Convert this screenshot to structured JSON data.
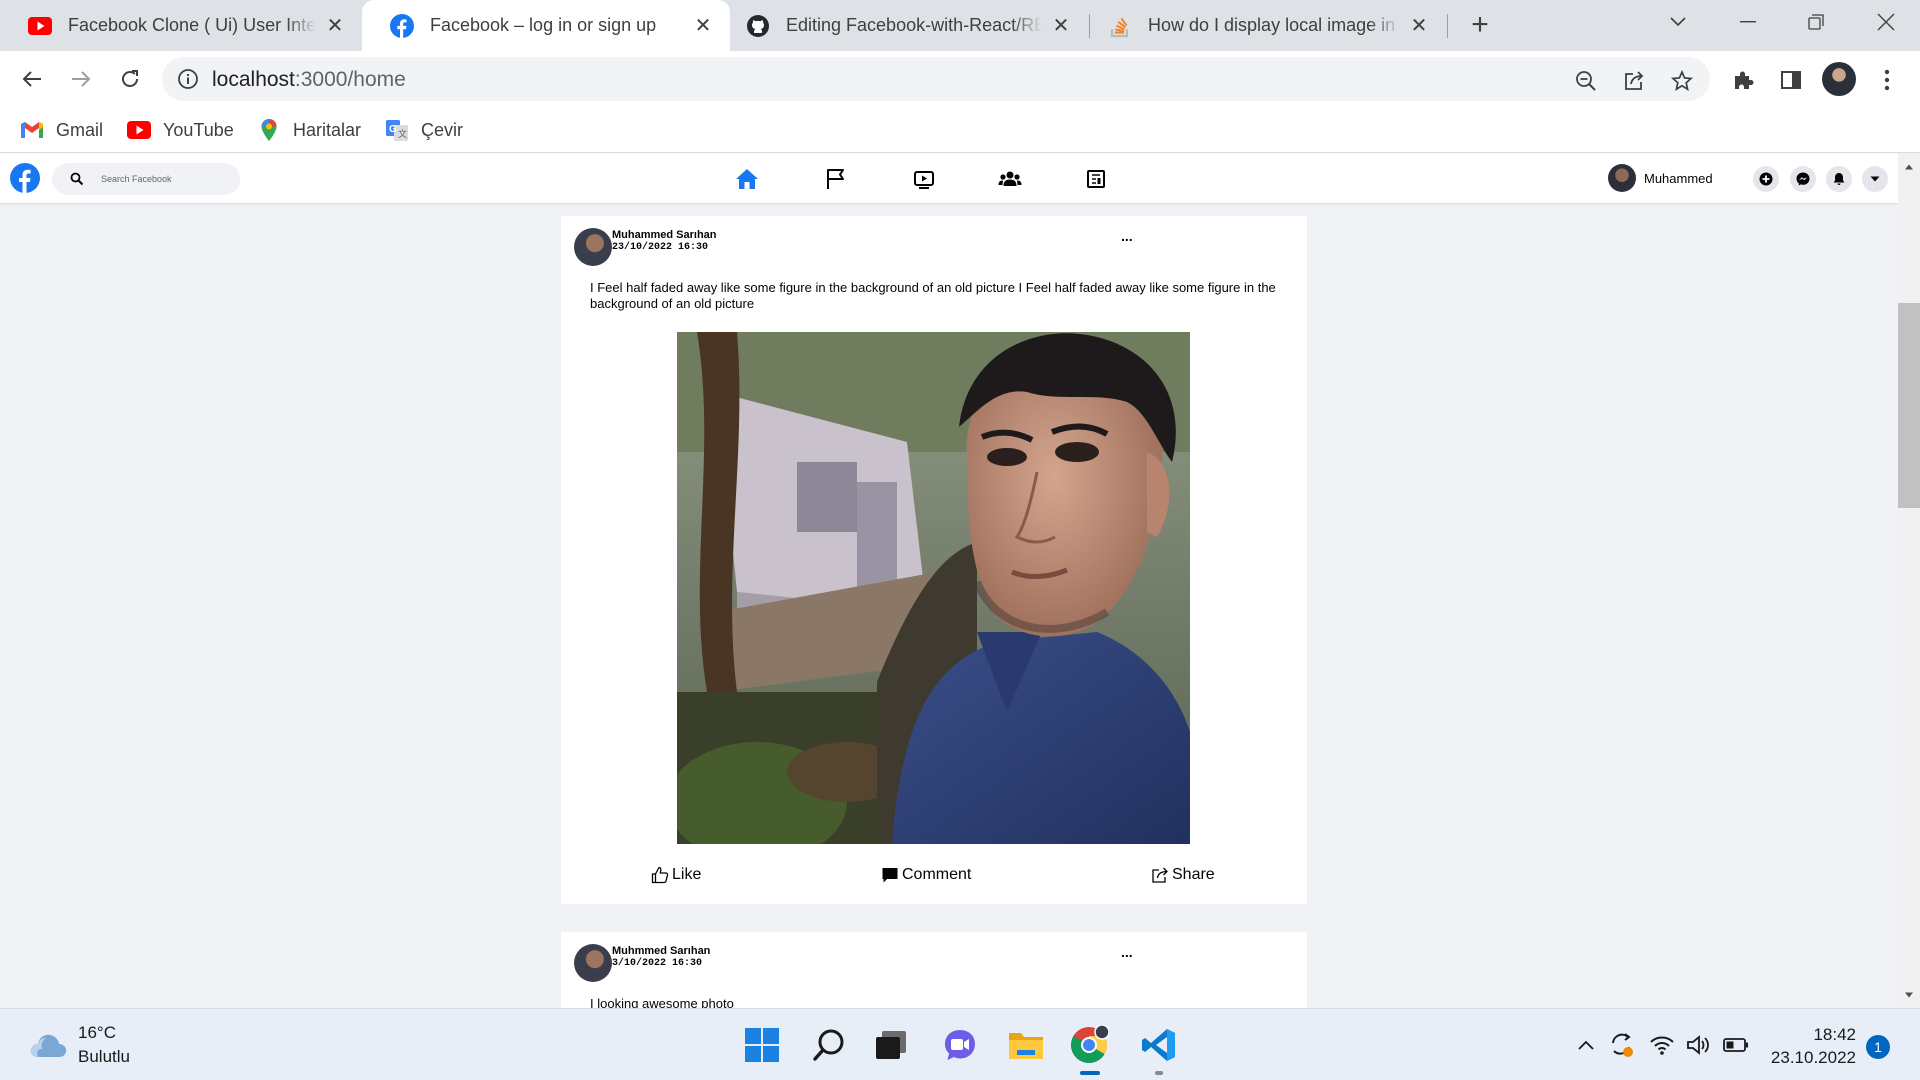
{
  "browser": {
    "tabs": [
      {
        "title": "Facebook Clone ( Ui) User Interface",
        "icon": "youtube-icon",
        "active": false
      },
      {
        "title": "Facebook – log in or sign up",
        "icon": "facebook-icon",
        "active": true
      },
      {
        "title": "Editing Facebook-with-React/README",
        "icon": "github-icon",
        "active": false
      },
      {
        "title": "How do I display local image in react",
        "icon": "stackoverflow-icon",
        "active": false
      }
    ],
    "new_tab_label": "+",
    "close_glyph": "✕",
    "address": {
      "host": "localhost",
      "path": ":3000/home"
    },
    "bookmarks": [
      {
        "label": "Gmail",
        "icon": "gmail-icon"
      },
      {
        "label": "YouTube",
        "icon": "youtube-icon"
      },
      {
        "label": "Haritalar",
        "icon": "maps-icon"
      },
      {
        "label": "Çevir",
        "icon": "translate-icon"
      }
    ],
    "colors": {
      "tabbar": "#dee1e6",
      "omnibox": "#f1f3f4"
    }
  },
  "facebook": {
    "search_placeholder": "Search Facebook",
    "user_name": "Muhammed",
    "brand_color": "#1877f2",
    "nav_icons": [
      "home-icon",
      "flag-icon",
      "video-icon",
      "groups-icon",
      "news-icon"
    ],
    "posts": [
      {
        "author": "Muhammed Sarıhan",
        "date": "23/10/2022 16:30",
        "more": "...",
        "text": "I Feel half faded away like some figure in the background of an old picture I Feel half faded away like some figure in the background of an old picture",
        "has_photo": true
      },
      {
        "author": "Muhmmed Sarıhan",
        "date": "3/10/2022 16:30",
        "more": "...",
        "text": "I looking awesome photo",
        "has_photo": false
      }
    ],
    "actions": {
      "like": "Like",
      "comment": "Comment",
      "share": "Share"
    }
  },
  "taskbar": {
    "weather": {
      "temp": "16°C",
      "condition": "Bulutlu"
    },
    "clock": {
      "time": "18:42",
      "date": "23.10.2022"
    },
    "notifications": "1",
    "apps": [
      "start-icon",
      "search-icon",
      "task-view-icon",
      "chat-icon",
      "file-explorer-icon",
      "chrome-icon",
      "vscode-icon"
    ]
  }
}
